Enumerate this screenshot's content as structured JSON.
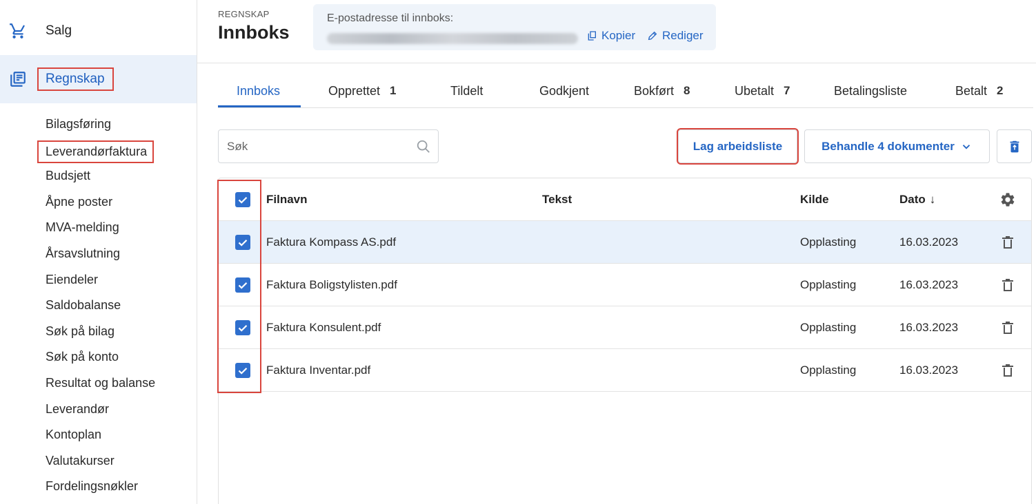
{
  "sidebar": {
    "salg": {
      "label": "Salg",
      "icon": "cart-icon"
    },
    "regnskap": {
      "label": "Regnskap",
      "icon": "ledger-icon"
    },
    "items": [
      "Bilagsføring",
      "Leverandørfaktura",
      "Budsjett",
      "Åpne poster",
      "MVA-melding",
      "Årsavslutning",
      "Eiendeler",
      "Saldobalanse",
      "Søk på bilag",
      "Søk på konto",
      "Resultat og balanse",
      "Leverandør",
      "Kontoplan",
      "Valutakurser",
      "Fordelingsnøkler"
    ]
  },
  "header": {
    "breadcrumb": "REGNSKAP",
    "title": "Innboks",
    "email_label": "E-postadresse til innboks:",
    "copy_label": "Kopier",
    "edit_label": "Rediger"
  },
  "tabs": [
    {
      "label": "Innboks",
      "count": ""
    },
    {
      "label": "Opprettet",
      "count": "1"
    },
    {
      "label": "Tildelt",
      "count": ""
    },
    {
      "label": "Godkjent",
      "count": ""
    },
    {
      "label": "Bokført",
      "count": "8"
    },
    {
      "label": "Ubetalt",
      "count": "7"
    },
    {
      "label": "Betalingsliste",
      "count": ""
    },
    {
      "label": "Betalt",
      "count": "2"
    }
  ],
  "toolbar": {
    "search_placeholder": "Søk",
    "make_worklist_label": "Lag arbeidsliste",
    "process_label": "Behandle 4 dokumenter"
  },
  "table": {
    "columns": {
      "filename": "Filnavn",
      "text": "Tekst",
      "source": "Kilde",
      "date": "Dato"
    },
    "rows": [
      {
        "filename": "Faktura Kompass AS.pdf",
        "text": "",
        "source": "Opplasting",
        "date": "16.03.2023",
        "checked": true
      },
      {
        "filename": "Faktura Boligstylisten.pdf",
        "text": "",
        "source": "Opplasting",
        "date": "16.03.2023",
        "checked": true
      },
      {
        "filename": "Faktura Konsulent.pdf",
        "text": "",
        "source": "Opplasting",
        "date": "16.03.2023",
        "checked": true
      },
      {
        "filename": "Faktura Inventar.pdf",
        "text": "",
        "source": "Opplasting",
        "date": "16.03.2023",
        "checked": true
      }
    ]
  },
  "colors": {
    "accent": "#2566c4",
    "selected_row": "#e8f1fb",
    "highlight_box": "#d9453d",
    "checkbox": "#2f6fcd"
  }
}
